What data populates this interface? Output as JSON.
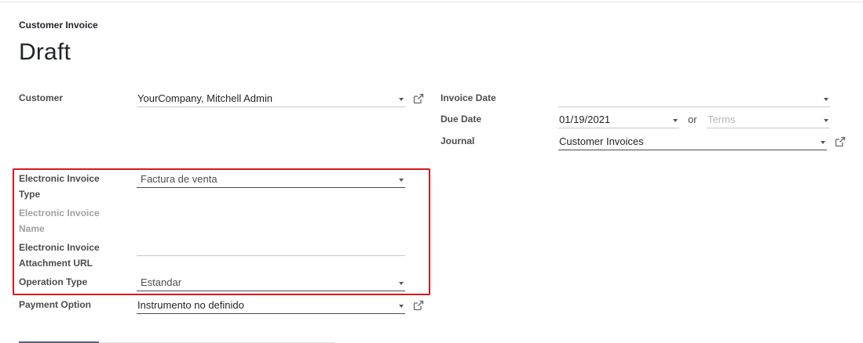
{
  "header": {
    "doc_type": "Customer Invoice",
    "state": "Draft"
  },
  "left": {
    "customer_label": "Customer",
    "customer_value": "YourCompany, Mitchell Admin",
    "e_invoice_type_label_1": "Electronic Invoice",
    "e_invoice_type_label_2": "Type",
    "e_invoice_type_value": "Factura de venta",
    "e_invoice_name_label_1": "Electronic Invoice",
    "e_invoice_name_label_2": "Name",
    "e_invoice_url_label_1": "Electronic Invoice",
    "e_invoice_url_label_2": "Attachment URL",
    "operation_type_label": "Operation Type",
    "operation_type_value": "Estandar",
    "payment_option_label": "Payment Option",
    "payment_option_value": "Instrumento no definido"
  },
  "right": {
    "invoice_date_label": "Invoice Date",
    "invoice_date_value": "",
    "due_date_label": "Due Date",
    "due_date_value": "01/19/2021",
    "or_text": "or",
    "terms_placeholder": "Terms",
    "journal_label": "Journal",
    "journal_value": "Customer Invoices"
  },
  "icons": {
    "external_link": "external-link-icon",
    "dropdown": "caret-down-icon"
  },
  "colors": {
    "highlight_border": "#d9161d",
    "label": "#4c4c4c",
    "muted_label": "#a0a0a0"
  }
}
